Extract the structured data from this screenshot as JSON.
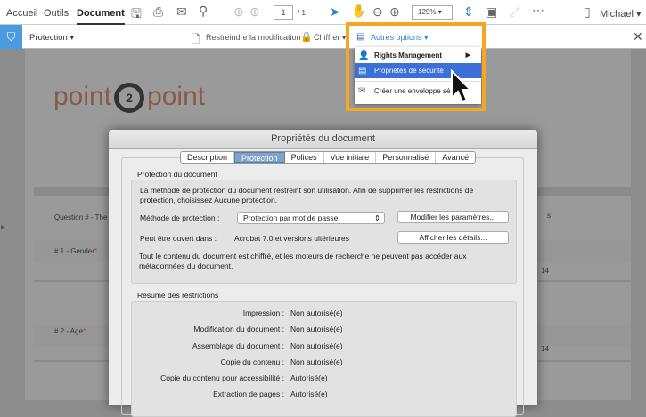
{
  "topbar": {
    "tabs": [
      "Accueil",
      "Outils",
      "Document"
    ],
    "page_current": "1",
    "page_total": "/ 1",
    "zoom": "129%",
    "user": "Michael"
  },
  "protbar": {
    "title": "Protection",
    "restrict": "Restreindre la modification",
    "encrypt": "Chiffrer",
    "more": "Autres options"
  },
  "menu": {
    "items": [
      "Rights Management",
      "Propriétés de sécurité",
      "Créer une enveloppe sé..."
    ]
  },
  "document": {
    "logo_left": "point",
    "logo_num": "2",
    "logo_right": "point",
    "question_header": "Question # - The",
    "q1": "# 1 - Gender",
    "q2": "# 2 - Age",
    "required": "*",
    "side1": "s",
    "side2": "14",
    "side3": "14"
  },
  "dialog": {
    "title": "Propriétés du document",
    "tabs": [
      "Description",
      "Protection",
      "Polices",
      "Vue initiale",
      "Personnalisé",
      "Avancé"
    ],
    "section1": "Protection du document",
    "intro": "La méthode de protection du document restreint son utilisation. Afin de supprimer les restrictions de protection, choisissez Aucune protection.",
    "method_label": "Méthode de protection :",
    "method_value": "Protection par mot de passe",
    "modify_btn": "Modifier les paramètres...",
    "open_label": "Peut être ouvert dans :",
    "open_value": "Acrobat 7.0 et versions ultérieures",
    "details_btn": "Afficher les détails...",
    "encrypted_note": "Tout le contenu du document est chiffré, et les moteurs de recherche ne peuvent pas accéder aux métadonnées du document.",
    "section2": "Résumé des restrictions",
    "restrictions": [
      {
        "label": "Impression :",
        "value": "Non autorisé(e)"
      },
      {
        "label": "Modification du document :",
        "value": "Non autorisé(e)"
      },
      {
        "label": "Assemblage du document :",
        "value": "Non autorisé(e)"
      },
      {
        "label": "Copie du contenu :",
        "value": "Non autorisé(e)"
      },
      {
        "label": "Copie du contenu pour accessibilité :",
        "value": "Autorisé(e)"
      },
      {
        "label": "Extraction de pages :",
        "value": "Autorisé(e)"
      }
    ]
  }
}
